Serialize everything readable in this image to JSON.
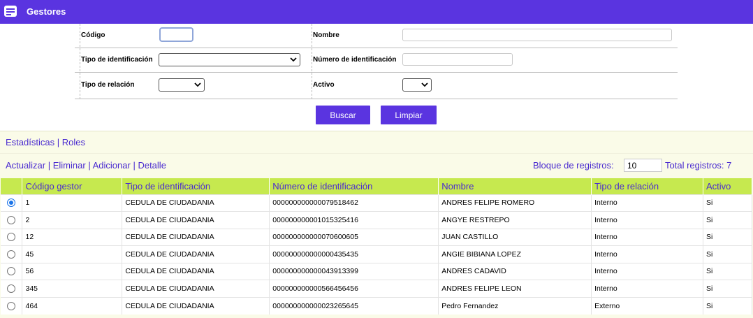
{
  "header": {
    "title": "Gestores",
    "icon": "list-icon",
    "background": "#5a34e0"
  },
  "filters": {
    "codigo": {
      "label": "Código",
      "value": ""
    },
    "nombre": {
      "label": "Nombre",
      "value": ""
    },
    "tipo_identificacion": {
      "label": "Tipo de identificación",
      "selected": ""
    },
    "numero_identificacion": {
      "label": "Número de identificación",
      "value": ""
    },
    "tipo_relacion": {
      "label": "Tipo de relación",
      "selected": ""
    },
    "activo": {
      "label": "Activo",
      "selected": ""
    }
  },
  "buttons": {
    "buscar": "Buscar",
    "limpiar": "Limpiar"
  },
  "links_top": {
    "estadisticas": "Estadísticas",
    "roles": "Roles",
    "separator": "|"
  },
  "actions": {
    "actualizar": "Actualizar",
    "eliminar": "Eliminar",
    "adicionar": "Adicionar",
    "detalle": "Detalle",
    "separator": "|"
  },
  "pagination": {
    "bloque_label": "Bloque de registros:",
    "bloque_value": "10",
    "total_label": "Total registros: 7"
  },
  "table": {
    "columns": [
      "Código gestor",
      "Tipo de identificación",
      "Número de identificación",
      "Nombre",
      "Tipo de relación",
      "Activo"
    ],
    "rows": [
      {
        "selected": true,
        "codigo": "1",
        "tipo": "CEDULA DE CIUDADANIA",
        "numero": "000000000000079518462",
        "nombre": "ANDRES FELIPE ROMERO",
        "relacion": "Interno",
        "activo": "Si"
      },
      {
        "selected": false,
        "codigo": "2",
        "tipo": "CEDULA DE CIUDADANIA",
        "numero": "000000000001015325416",
        "nombre": "ANGYE RESTREPO",
        "relacion": "Interno",
        "activo": "Si"
      },
      {
        "selected": false,
        "codigo": "12",
        "tipo": "CEDULA DE CIUDADANIA",
        "numero": "000000000000070600605",
        "nombre": "JUAN CASTILLO",
        "relacion": "Interno",
        "activo": "Si"
      },
      {
        "selected": false,
        "codigo": "45",
        "tipo": "CEDULA DE CIUDADANIA",
        "numero": "000000000000000435435",
        "nombre": "ANGIE BIBIANA LOPEZ",
        "relacion": "Interno",
        "activo": "Si"
      },
      {
        "selected": false,
        "codigo": "56",
        "tipo": "CEDULA DE CIUDADANIA",
        "numero": "000000000000043913399",
        "nombre": "ANDRES CADAVID",
        "relacion": "Interno",
        "activo": "Si"
      },
      {
        "selected": false,
        "codigo": "345",
        "tipo": "CEDULA DE CIUDADANIA",
        "numero": "000000000000566456456",
        "nombre": "ANDRES FELIPE LEON",
        "relacion": "Interno",
        "activo": "Si"
      },
      {
        "selected": false,
        "codigo": "464",
        "tipo": "CEDULA DE CIUDADANIA",
        "numero": "000000000000023265645",
        "nombre": "Pedro Fernandez",
        "relacion": "Externo",
        "activo": "Si"
      }
    ]
  },
  "colors": {
    "accent": "#5a34e0",
    "table_header": "#c6e94f",
    "link": "#4a2bd0",
    "panel": "#fafbe8"
  }
}
